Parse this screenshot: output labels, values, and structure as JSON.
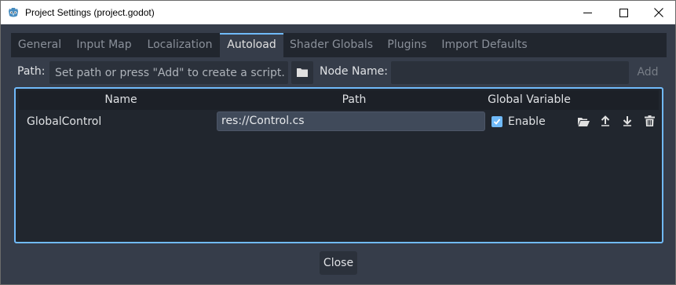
{
  "window": {
    "title": "Project Settings (project.godot)",
    "icon": "godot-icon",
    "controls": [
      "minimize-icon",
      "maximize-icon",
      "close-icon"
    ]
  },
  "tabs": [
    {
      "label": "General",
      "active": false
    },
    {
      "label": "Input Map",
      "active": false
    },
    {
      "label": "Localization",
      "active": false
    },
    {
      "label": "Autoload",
      "active": true
    },
    {
      "label": "Shader Globals",
      "active": false
    },
    {
      "label": "Plugins",
      "active": false
    },
    {
      "label": "Import Defaults",
      "active": false
    }
  ],
  "autoload": {
    "path_label": "Path:",
    "path_placeholder": "Set path or press \"Add\" to create a script.",
    "path_value": "",
    "node_name_label": "Node Name:",
    "node_name_value": "",
    "add_label": "Add",
    "columns": [
      "Name",
      "Path",
      "Global Variable"
    ],
    "rows": [
      {
        "name": "GlobalControl",
        "path": "res://Control.cs",
        "enabled": true,
        "enable_label": "Enable"
      }
    ]
  },
  "footer": {
    "close_label": "Close"
  },
  "colors": {
    "accent": "#70bafa",
    "background": "#363d4a",
    "panel": "#21262e"
  }
}
